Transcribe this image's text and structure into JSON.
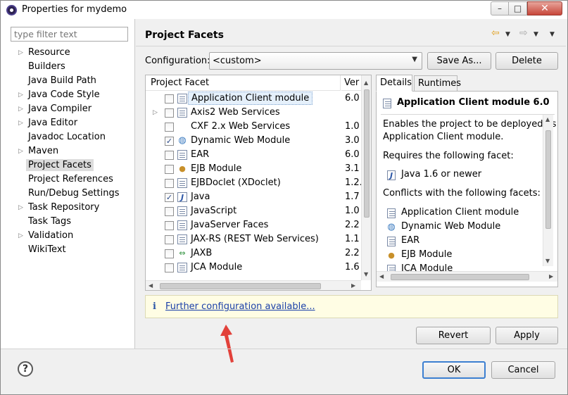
{
  "window": {
    "title": "Properties for mydemo",
    "minimize": "–",
    "maximize": "□",
    "close": "✕"
  },
  "filter": {
    "placeholder": "type filter text"
  },
  "tree": [
    {
      "label": "Resource",
      "expandable": true
    },
    {
      "label": "Builders",
      "expandable": false
    },
    {
      "label": "Java Build Path",
      "expandable": false
    },
    {
      "label": "Java Code Style",
      "expandable": true
    },
    {
      "label": "Java Compiler",
      "expandable": true
    },
    {
      "label": "Java Editor",
      "expandable": true
    },
    {
      "label": "Javadoc Location",
      "expandable": false
    },
    {
      "label": "Maven",
      "expandable": true
    },
    {
      "label": "Project Facets",
      "expandable": false,
      "selected": true
    },
    {
      "label": "Project References",
      "expandable": false
    },
    {
      "label": "Run/Debug Settings",
      "expandable": false
    },
    {
      "label": "Task Repository",
      "expandable": true
    },
    {
      "label": "Task Tags",
      "expandable": false
    },
    {
      "label": "Validation",
      "expandable": true
    },
    {
      "label": "WikiText",
      "expandable": false
    }
  ],
  "page": {
    "title": "Project Facets"
  },
  "configuration": {
    "label": "Configuration:",
    "value": "<custom>",
    "save_as": "Save As...",
    "delete": "Delete"
  },
  "facets": {
    "col_facet": "Project Facet",
    "col_version": "Ver",
    "rows": [
      {
        "name": "Application Client module",
        "version": "6.0",
        "checked": false,
        "icon": "file-icon",
        "selected": true
      },
      {
        "name": "Axis2 Web Services",
        "version": "",
        "checked": false,
        "icon": "file-icon",
        "expandable": true
      },
      {
        "name": "CXF 2.x Web Services",
        "version": "1.0",
        "checked": false,
        "icon": "none"
      },
      {
        "name": "Dynamic Web Module",
        "version": "3.0",
        "checked": true,
        "icon": "globe-icon"
      },
      {
        "name": "EAR",
        "version": "6.0",
        "checked": false,
        "icon": "file-icon"
      },
      {
        "name": "EJB Module",
        "version": "3.1",
        "checked": false,
        "icon": "bean-icon"
      },
      {
        "name": "EJBDoclet (XDoclet)",
        "version": "1.2.",
        "checked": false,
        "icon": "file-icon"
      },
      {
        "name": "Java",
        "version": "1.7",
        "checked": true,
        "icon": "java-icon"
      },
      {
        "name": "JavaScript",
        "version": "1.0",
        "checked": false,
        "icon": "file-icon"
      },
      {
        "name": "JavaServer Faces",
        "version": "2.2",
        "checked": false,
        "icon": "file-icon"
      },
      {
        "name": "JAX-RS (REST Web Services)",
        "version": "1.1",
        "checked": false,
        "icon": "file-icon"
      },
      {
        "name": "JAXB",
        "version": "2.2",
        "checked": false,
        "icon": "jaxb-icon"
      },
      {
        "name": "JCA Module",
        "version": "1.6",
        "checked": false,
        "icon": "file-icon"
      }
    ]
  },
  "details": {
    "tab_details": "Details",
    "tab_runtimes": "Runtimes",
    "heading": "Application Client module 6.0",
    "desc_line1": "Enables the project to be deployed as",
    "desc_line2": "Application Client module.",
    "requires_label": "Requires the following facet:",
    "requires_item": "Java 1.6 or newer",
    "conflicts_label": "Conflicts with the following facets:",
    "conflicts": [
      {
        "name": "Application Client module",
        "icon": "file-icon"
      },
      {
        "name": "Dynamic Web Module",
        "icon": "globe-icon"
      },
      {
        "name": "EAR",
        "icon": "file-icon"
      },
      {
        "name": "EJB Module",
        "icon": "bean-icon"
      },
      {
        "name": "JCA Module",
        "icon": "file-icon"
      }
    ]
  },
  "info": {
    "icon": "i",
    "link": "Further configuration available..."
  },
  "buttons": {
    "revert": "Revert",
    "apply": "Apply",
    "ok": "OK",
    "cancel": "Cancel",
    "help": "?"
  },
  "colors": {
    "link": "#1a3fa8",
    "info_bg": "#fffde4",
    "arrow": "#e2413a",
    "nav_back": "#e0a020"
  }
}
